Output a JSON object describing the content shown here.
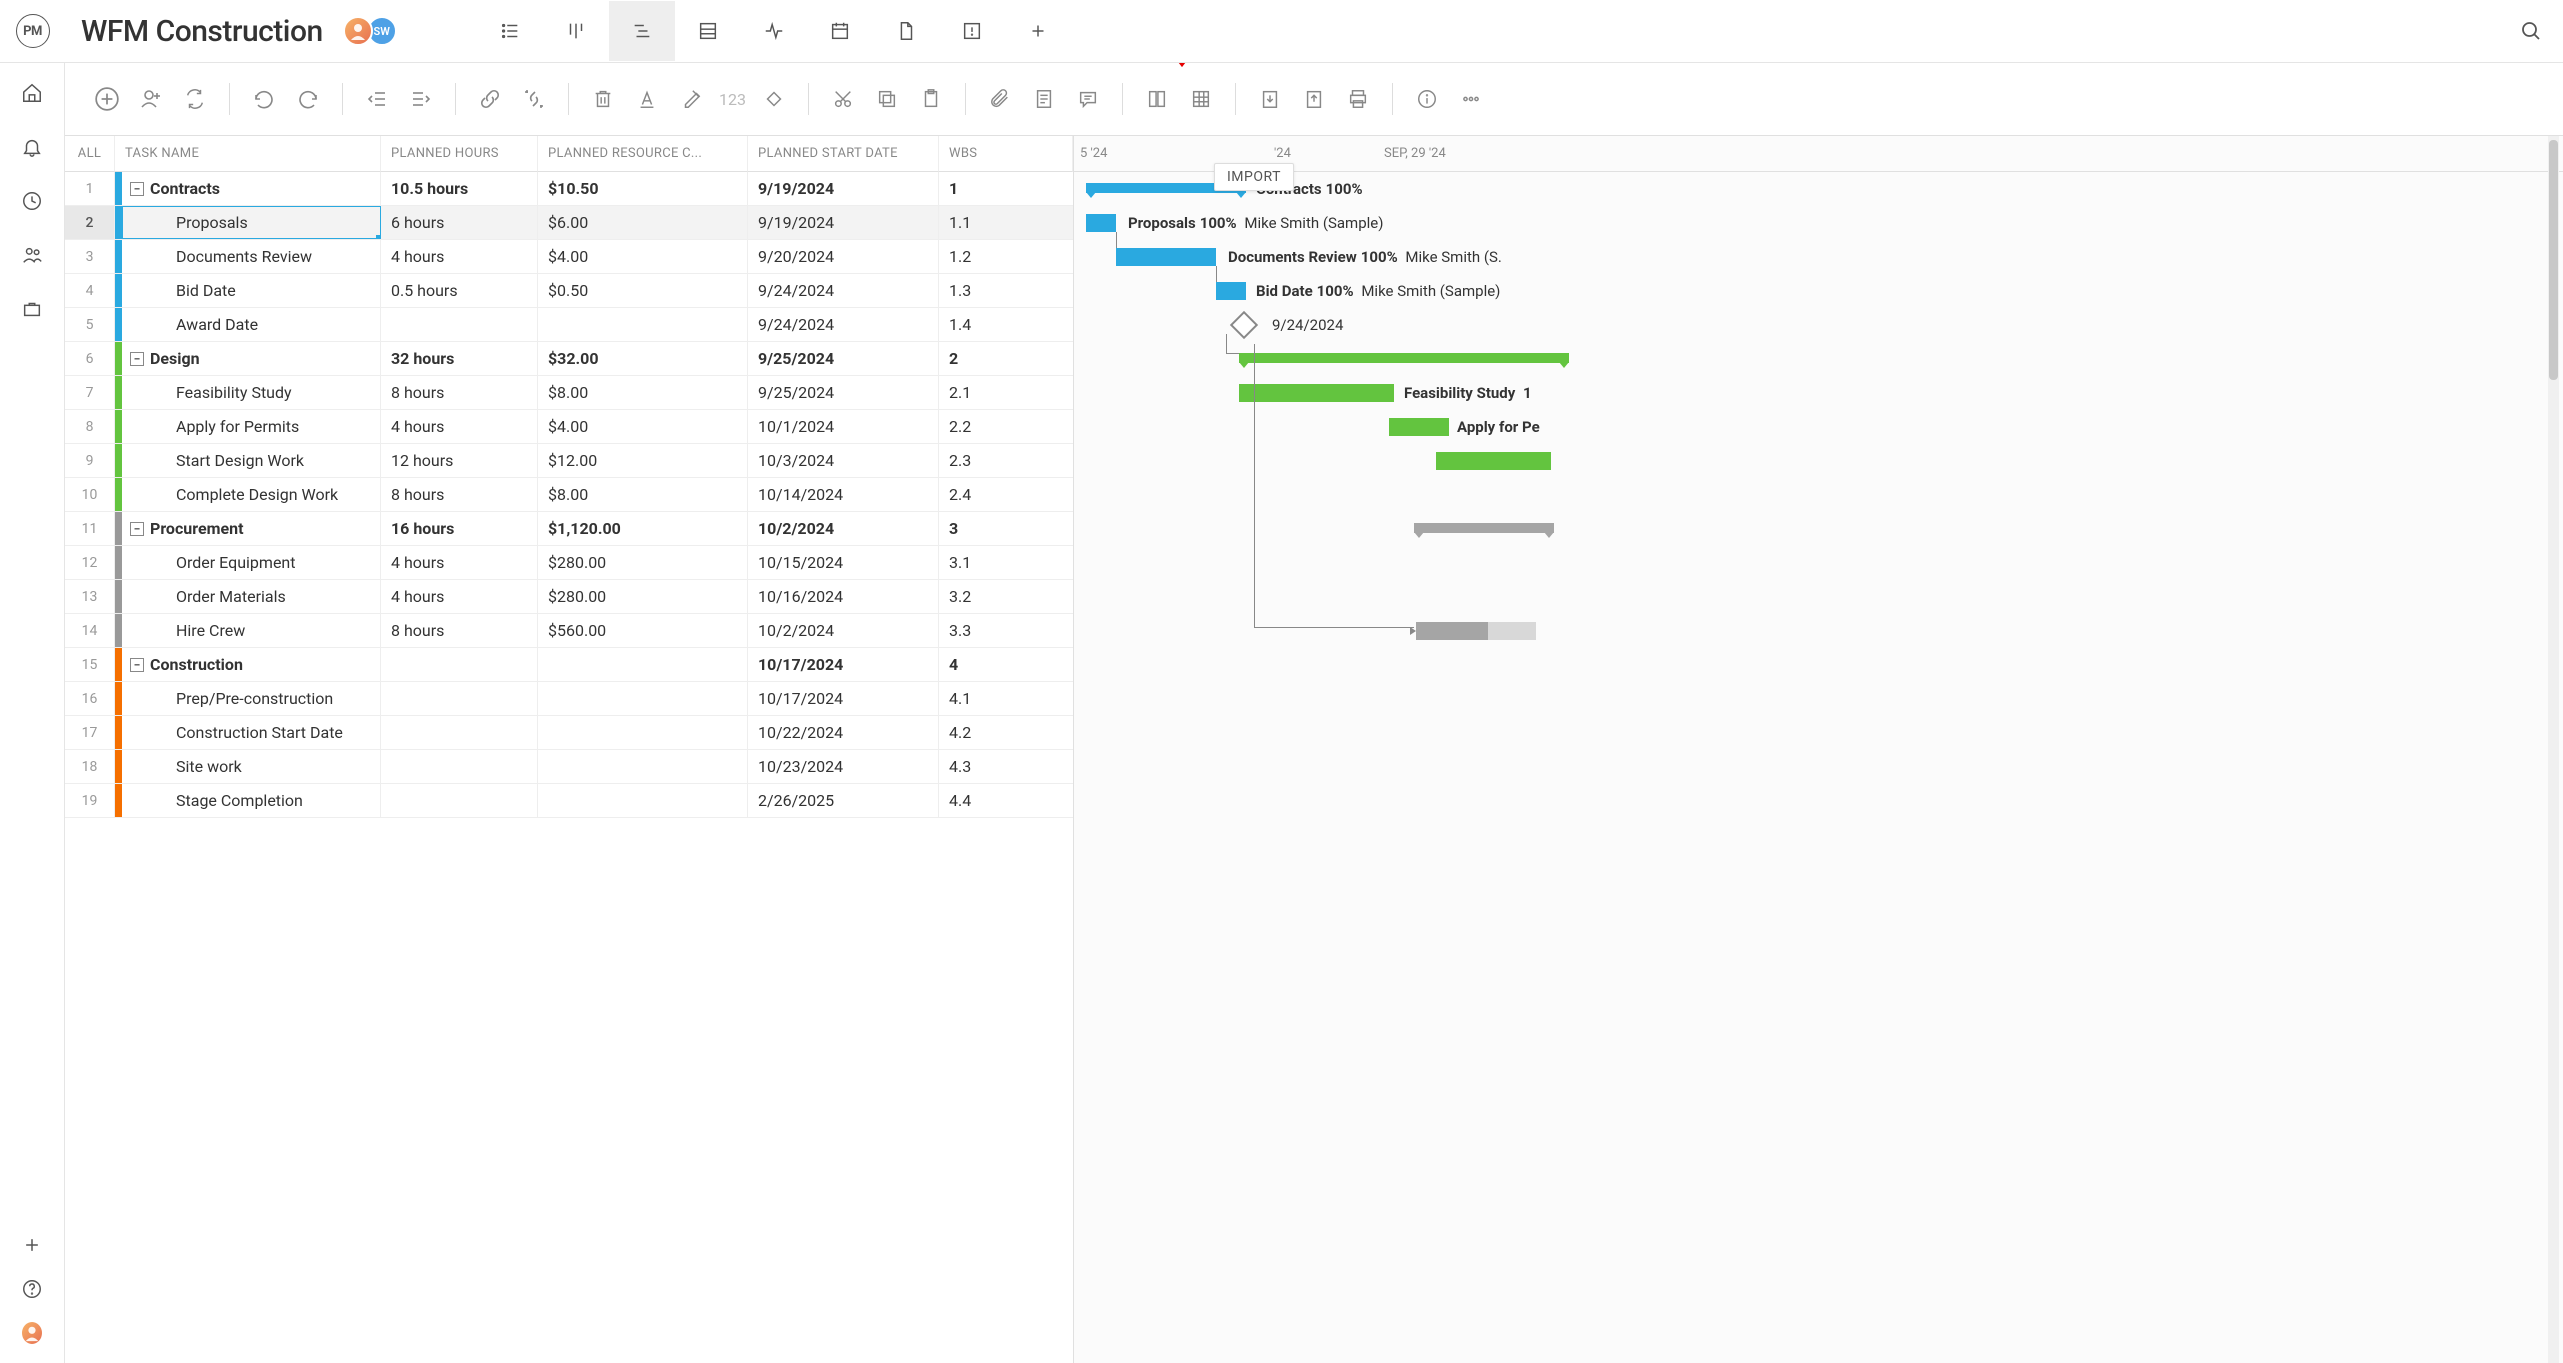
{
  "logo_text": "PM",
  "project_title": "WFM Construction",
  "avatars": [
    {
      "initials": "",
      "class": "a1"
    },
    {
      "initials": "SW",
      "class": "a2"
    }
  ],
  "tooltip_text": "IMPORT",
  "id_placeholder": "123",
  "grid": {
    "all_label": "ALL",
    "headers": {
      "task": "TASK NAME",
      "hours": "PLANNED HOURS",
      "cost": "PLANNED RESOURCE C...",
      "start": "PLANNED START DATE",
      "wbs": "WBS"
    }
  },
  "gantt_header": {
    "left": "5 '24",
    "mid": "'24",
    "right": "SEP, 29 '24"
  },
  "rows": [
    {
      "num": "1",
      "color": "c-blue",
      "summary": true,
      "name": "Contracts",
      "hours": "10.5 hours",
      "cost": "$10.50",
      "start": "9/19/2024",
      "wbs": "1"
    },
    {
      "num": "2",
      "color": "c-blue",
      "summary": false,
      "name": "Proposals",
      "hours": "6 hours",
      "cost": "$6.00",
      "start": "9/19/2024",
      "wbs": "1.1",
      "selected": true
    },
    {
      "num": "3",
      "color": "c-blue",
      "summary": false,
      "name": "Documents Review",
      "hours": "4 hours",
      "cost": "$4.00",
      "start": "9/20/2024",
      "wbs": "1.2"
    },
    {
      "num": "4",
      "color": "c-blue",
      "summary": false,
      "name": "Bid Date",
      "hours": "0.5 hours",
      "cost": "$0.50",
      "start": "9/24/2024",
      "wbs": "1.3"
    },
    {
      "num": "5",
      "color": "c-blue",
      "summary": false,
      "name": "Award Date",
      "hours": "",
      "cost": "",
      "start": "9/24/2024",
      "wbs": "1.4"
    },
    {
      "num": "6",
      "color": "c-green",
      "summary": true,
      "name": "Design",
      "hours": "32 hours",
      "cost": "$32.00",
      "start": "9/25/2024",
      "wbs": "2"
    },
    {
      "num": "7",
      "color": "c-green",
      "summary": false,
      "name": "Feasibility Study",
      "hours": "8 hours",
      "cost": "$8.00",
      "start": "9/25/2024",
      "wbs": "2.1"
    },
    {
      "num": "8",
      "color": "c-green",
      "summary": false,
      "name": "Apply for Permits",
      "hours": "4 hours",
      "cost": "$4.00",
      "start": "10/1/2024",
      "wbs": "2.2"
    },
    {
      "num": "9",
      "color": "c-green",
      "summary": false,
      "name": "Start Design Work",
      "hours": "12 hours",
      "cost": "$12.00",
      "start": "10/3/2024",
      "wbs": "2.3"
    },
    {
      "num": "10",
      "color": "c-green",
      "summary": false,
      "name": "Complete Design Work",
      "hours": "8 hours",
      "cost": "$8.00",
      "start": "10/14/2024",
      "wbs": "2.4"
    },
    {
      "num": "11",
      "color": "c-gray",
      "summary": true,
      "name": "Procurement",
      "hours": "16 hours",
      "cost": "$1,120.00",
      "start": "10/2/2024",
      "wbs": "3"
    },
    {
      "num": "12",
      "color": "c-gray",
      "summary": false,
      "name": "Order Equipment",
      "hours": "4 hours",
      "cost": "$280.00",
      "start": "10/15/2024",
      "wbs": "3.1"
    },
    {
      "num": "13",
      "color": "c-gray",
      "summary": false,
      "name": "Order Materials",
      "hours": "4 hours",
      "cost": "$280.00",
      "start": "10/16/2024",
      "wbs": "3.2"
    },
    {
      "num": "14",
      "color": "c-gray",
      "summary": false,
      "name": "Hire Crew",
      "hours": "8 hours",
      "cost": "$560.00",
      "start": "10/2/2024",
      "wbs": "3.3"
    },
    {
      "num": "15",
      "color": "c-orange",
      "summary": true,
      "name": "Construction",
      "hours": "",
      "cost": "",
      "start": "10/17/2024",
      "wbs": "4"
    },
    {
      "num": "16",
      "color": "c-orange",
      "summary": false,
      "name": "Prep/Pre-construction",
      "hours": "",
      "cost": "",
      "start": "10/17/2024",
      "wbs": "4.1"
    },
    {
      "num": "17",
      "color": "c-orange",
      "summary": false,
      "name": "Construction Start Date",
      "hours": "",
      "cost": "",
      "start": "10/22/2024",
      "wbs": "4.2"
    },
    {
      "num": "18",
      "color": "c-orange",
      "summary": false,
      "name": "Site work",
      "hours": "",
      "cost": "",
      "start": "10/23/2024",
      "wbs": "4.3"
    },
    {
      "num": "19",
      "color": "c-orange",
      "summary": false,
      "name": "Stage Completion",
      "hours": "",
      "cost": "",
      "start": "2/26/2025",
      "wbs": "4.4"
    }
  ],
  "gantt_labels": {
    "r0": {
      "bold": "Contracts",
      "pct": "100%",
      "rest": ""
    },
    "r1": {
      "bold": "Proposals",
      "pct": "100%",
      "rest": "Mike Smith (Sample)"
    },
    "r2": {
      "bold": "Documents Review",
      "pct": "100%",
      "rest": "Mike Smith (S."
    },
    "r3": {
      "bold": "Bid Date",
      "pct": "100%",
      "rest": "Mike Smith (Sample)"
    },
    "r4": {
      "bold": "",
      "pct": "",
      "rest": "9/24/2024"
    },
    "r6": {
      "bold": "Feasibility Study",
      "pct": "1",
      "rest": ""
    },
    "r7": {
      "bold": "Apply for Pe",
      "pct": "",
      "rest": ""
    }
  }
}
